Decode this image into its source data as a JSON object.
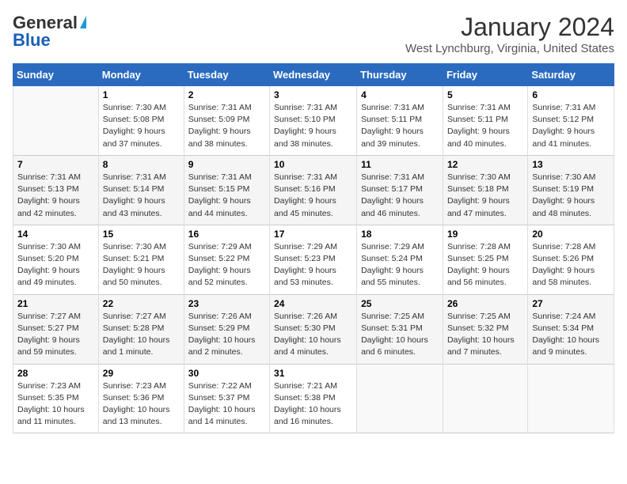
{
  "logo": {
    "general": "General",
    "blue": "Blue"
  },
  "title": "January 2024",
  "location": "West Lynchburg, Virginia, United States",
  "days_header": [
    "Sunday",
    "Monday",
    "Tuesday",
    "Wednesday",
    "Thursday",
    "Friday",
    "Saturday"
  ],
  "weeks": [
    [
      {
        "day": "",
        "sunrise": "",
        "sunset": "",
        "daylight": ""
      },
      {
        "day": "1",
        "sunrise": "Sunrise: 7:30 AM",
        "sunset": "Sunset: 5:08 PM",
        "daylight": "Daylight: 9 hours and 37 minutes."
      },
      {
        "day": "2",
        "sunrise": "Sunrise: 7:31 AM",
        "sunset": "Sunset: 5:09 PM",
        "daylight": "Daylight: 9 hours and 38 minutes."
      },
      {
        "day": "3",
        "sunrise": "Sunrise: 7:31 AM",
        "sunset": "Sunset: 5:10 PM",
        "daylight": "Daylight: 9 hours and 38 minutes."
      },
      {
        "day": "4",
        "sunrise": "Sunrise: 7:31 AM",
        "sunset": "Sunset: 5:11 PM",
        "daylight": "Daylight: 9 hours and 39 minutes."
      },
      {
        "day": "5",
        "sunrise": "Sunrise: 7:31 AM",
        "sunset": "Sunset: 5:11 PM",
        "daylight": "Daylight: 9 hours and 40 minutes."
      },
      {
        "day": "6",
        "sunrise": "Sunrise: 7:31 AM",
        "sunset": "Sunset: 5:12 PM",
        "daylight": "Daylight: 9 hours and 41 minutes."
      }
    ],
    [
      {
        "day": "7",
        "sunrise": "Sunrise: 7:31 AM",
        "sunset": "Sunset: 5:13 PM",
        "daylight": "Daylight: 9 hours and 42 minutes."
      },
      {
        "day": "8",
        "sunrise": "Sunrise: 7:31 AM",
        "sunset": "Sunset: 5:14 PM",
        "daylight": "Daylight: 9 hours and 43 minutes."
      },
      {
        "day": "9",
        "sunrise": "Sunrise: 7:31 AM",
        "sunset": "Sunset: 5:15 PM",
        "daylight": "Daylight: 9 hours and 44 minutes."
      },
      {
        "day": "10",
        "sunrise": "Sunrise: 7:31 AM",
        "sunset": "Sunset: 5:16 PM",
        "daylight": "Daylight: 9 hours and 45 minutes."
      },
      {
        "day": "11",
        "sunrise": "Sunrise: 7:31 AM",
        "sunset": "Sunset: 5:17 PM",
        "daylight": "Daylight: 9 hours and 46 minutes."
      },
      {
        "day": "12",
        "sunrise": "Sunrise: 7:30 AM",
        "sunset": "Sunset: 5:18 PM",
        "daylight": "Daylight: 9 hours and 47 minutes."
      },
      {
        "day": "13",
        "sunrise": "Sunrise: 7:30 AM",
        "sunset": "Sunset: 5:19 PM",
        "daylight": "Daylight: 9 hours and 48 minutes."
      }
    ],
    [
      {
        "day": "14",
        "sunrise": "Sunrise: 7:30 AM",
        "sunset": "Sunset: 5:20 PM",
        "daylight": "Daylight: 9 hours and 49 minutes."
      },
      {
        "day": "15",
        "sunrise": "Sunrise: 7:30 AM",
        "sunset": "Sunset: 5:21 PM",
        "daylight": "Daylight: 9 hours and 50 minutes."
      },
      {
        "day": "16",
        "sunrise": "Sunrise: 7:29 AM",
        "sunset": "Sunset: 5:22 PM",
        "daylight": "Daylight: 9 hours and 52 minutes."
      },
      {
        "day": "17",
        "sunrise": "Sunrise: 7:29 AM",
        "sunset": "Sunset: 5:23 PM",
        "daylight": "Daylight: 9 hours and 53 minutes."
      },
      {
        "day": "18",
        "sunrise": "Sunrise: 7:29 AM",
        "sunset": "Sunset: 5:24 PM",
        "daylight": "Daylight: 9 hours and 55 minutes."
      },
      {
        "day": "19",
        "sunrise": "Sunrise: 7:28 AM",
        "sunset": "Sunset: 5:25 PM",
        "daylight": "Daylight: 9 hours and 56 minutes."
      },
      {
        "day": "20",
        "sunrise": "Sunrise: 7:28 AM",
        "sunset": "Sunset: 5:26 PM",
        "daylight": "Daylight: 9 hours and 58 minutes."
      }
    ],
    [
      {
        "day": "21",
        "sunrise": "Sunrise: 7:27 AM",
        "sunset": "Sunset: 5:27 PM",
        "daylight": "Daylight: 9 hours and 59 minutes."
      },
      {
        "day": "22",
        "sunrise": "Sunrise: 7:27 AM",
        "sunset": "Sunset: 5:28 PM",
        "daylight": "Daylight: 10 hours and 1 minute."
      },
      {
        "day": "23",
        "sunrise": "Sunrise: 7:26 AM",
        "sunset": "Sunset: 5:29 PM",
        "daylight": "Daylight: 10 hours and 2 minutes."
      },
      {
        "day": "24",
        "sunrise": "Sunrise: 7:26 AM",
        "sunset": "Sunset: 5:30 PM",
        "daylight": "Daylight: 10 hours and 4 minutes."
      },
      {
        "day": "25",
        "sunrise": "Sunrise: 7:25 AM",
        "sunset": "Sunset: 5:31 PM",
        "daylight": "Daylight: 10 hours and 6 minutes."
      },
      {
        "day": "26",
        "sunrise": "Sunrise: 7:25 AM",
        "sunset": "Sunset: 5:32 PM",
        "daylight": "Daylight: 10 hours and 7 minutes."
      },
      {
        "day": "27",
        "sunrise": "Sunrise: 7:24 AM",
        "sunset": "Sunset: 5:34 PM",
        "daylight": "Daylight: 10 hours and 9 minutes."
      }
    ],
    [
      {
        "day": "28",
        "sunrise": "Sunrise: 7:23 AM",
        "sunset": "Sunset: 5:35 PM",
        "daylight": "Daylight: 10 hours and 11 minutes."
      },
      {
        "day": "29",
        "sunrise": "Sunrise: 7:23 AM",
        "sunset": "Sunset: 5:36 PM",
        "daylight": "Daylight: 10 hours and 13 minutes."
      },
      {
        "day": "30",
        "sunrise": "Sunrise: 7:22 AM",
        "sunset": "Sunset: 5:37 PM",
        "daylight": "Daylight: 10 hours and 14 minutes."
      },
      {
        "day": "31",
        "sunrise": "Sunrise: 7:21 AM",
        "sunset": "Sunset: 5:38 PM",
        "daylight": "Daylight: 10 hours and 16 minutes."
      },
      {
        "day": "",
        "sunrise": "",
        "sunset": "",
        "daylight": ""
      },
      {
        "day": "",
        "sunrise": "",
        "sunset": "",
        "daylight": ""
      },
      {
        "day": "",
        "sunrise": "",
        "sunset": "",
        "daylight": ""
      }
    ]
  ]
}
